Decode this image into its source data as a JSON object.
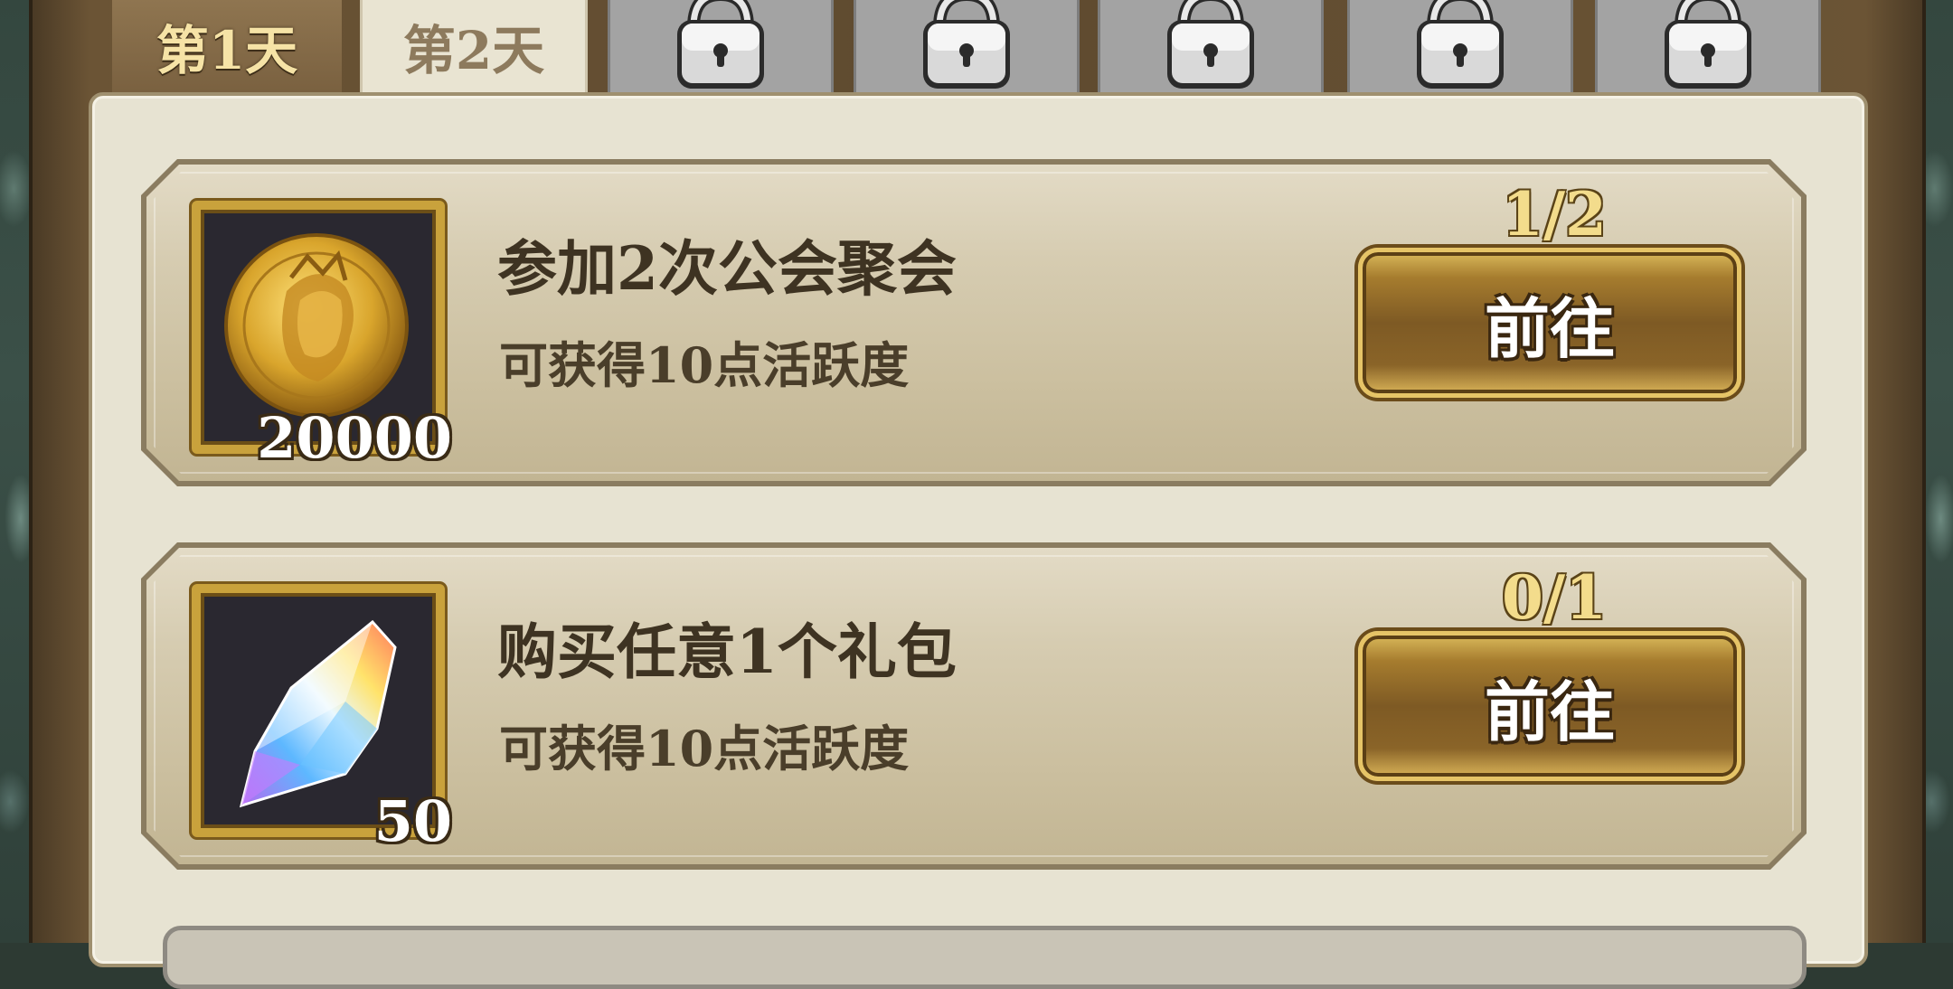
{
  "tabs": [
    {
      "label": "第1天",
      "state": "active"
    },
    {
      "label": "第2天",
      "state": "open"
    },
    {
      "state": "locked",
      "icon": "lock-icon"
    },
    {
      "state": "locked",
      "icon": "lock-icon"
    },
    {
      "state": "locked",
      "icon": "lock-icon"
    },
    {
      "state": "locked",
      "icon": "lock-icon"
    },
    {
      "state": "locked",
      "icon": "lock-icon"
    }
  ],
  "tasks": [
    {
      "title": "参加2次公会聚会",
      "reward_text": "可获得10点活跃度",
      "item_icon": "gold-coin-icon",
      "item_quantity": "20000",
      "progress": "1/2",
      "button_label": "前往"
    },
    {
      "title": "购买任意1个礼包",
      "reward_text": "可获得10点活跃度",
      "item_icon": "rainbow-crystal-icon",
      "item_quantity": "50",
      "progress": "0/1",
      "button_label": "前往"
    }
  ],
  "colors": {
    "accent_gold": "#c9a23c",
    "panel_bg": "#e7e3d2",
    "text_dark": "#3e3322"
  }
}
